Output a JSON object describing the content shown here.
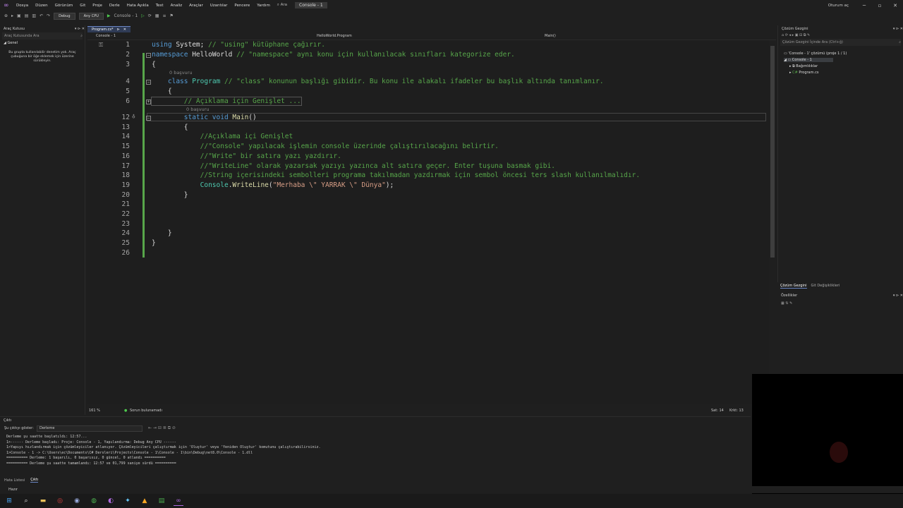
{
  "menubar": {
    "items": [
      "Dosya",
      "Düzen",
      "Görünüm",
      "Git",
      "Proje",
      "Derle",
      "Hata Ayıkla",
      "Test",
      "Analiz",
      "Araçlar",
      "Uzantılar",
      "Pencere",
      "Yardım"
    ],
    "search_label": "Ara",
    "solution_name": "Console - 1",
    "user_label": "Oturum aç"
  },
  "toolbar": {
    "config": "Debug",
    "platform": "Any CPU",
    "run_target": "Console - 1"
  },
  "toolbox": {
    "title": "Araç Kutusu",
    "search_placeholder": "Araç Kutusunda Ara",
    "group": "Genel",
    "empty_message": "Bu grupta kullanılabilir denetim yok. Araç çubuğuna bir öğe eklemek için üzerine sürükleyin."
  },
  "editor": {
    "tab_label": "Program.cs*",
    "project": "Console - 1",
    "class_nav": "HelloWorld.Program",
    "member_nav": "Main()",
    "zoom": "161 %",
    "issues": "Sorun bulunamadı",
    "line_col": "Sat: 14",
    "char_col": "Krkt: 13",
    "refs1": "0 başvuru",
    "refs2": "0 başvuru",
    "lines": [
      {
        "n": "1",
        "t": [
          {
            "c": "kw",
            "s": "using "
          },
          {
            "c": "",
            "s": "System; "
          },
          {
            "c": "cm",
            "s": "// \"using\" kütüphane çağırır."
          }
        ]
      },
      {
        "n": "2",
        "t": [
          {
            "c": "kw",
            "s": "namespace "
          },
          {
            "c": "",
            "s": "HelloWorld "
          },
          {
            "c": "cm",
            "s": "// \"namespace\" aynı konu için kullanılacak sınıfları kategorize eder."
          }
        ]
      },
      {
        "n": "3",
        "t": [
          {
            "c": "",
            "s": "{"
          }
        ]
      },
      {
        "n": "4",
        "t": [
          {
            "c": "",
            "s": "    "
          },
          {
            "c": "kw",
            "s": "class "
          },
          {
            "c": "tp",
            "s": "Program "
          },
          {
            "c": "cm",
            "s": "// \"class\" konunun başlığı gibidir. Bu konu ile alakalı ifadeler bu başlık altında tanımlanır."
          }
        ]
      },
      {
        "n": "5",
        "t": [
          {
            "c": "",
            "s": "    {"
          }
        ]
      },
      {
        "n": "6",
        "t": [
          {
            "c": "",
            "s": "        "
          },
          {
            "c": "cm",
            "s": "// Açıklama için Genişlet ..."
          }
        ]
      },
      {
        "n": "12",
        "t": [
          {
            "c": "",
            "s": "        "
          },
          {
            "c": "kw",
            "s": "static void "
          },
          {
            "c": "mt",
            "s": "Main"
          },
          {
            "c": "",
            "s": "()"
          }
        ]
      },
      {
        "n": "13",
        "t": [
          {
            "c": "",
            "s": "        {"
          }
        ]
      },
      {
        "n": "14",
        "t": [
          {
            "c": "",
            "s": "            "
          },
          {
            "c": "cm",
            "s": "//Açıklama içi Genişlet"
          }
        ]
      },
      {
        "n": "15",
        "t": [
          {
            "c": "",
            "s": "            "
          },
          {
            "c": "cm",
            "s": "//\"Console\" yapılacak işlemin console üzerinde çalıştırılacağını belirtir."
          }
        ]
      },
      {
        "n": "16",
        "t": [
          {
            "c": "",
            "s": "            "
          },
          {
            "c": "cm",
            "s": "//\"Write\" bir satıra yazı yazdırır."
          }
        ]
      },
      {
        "n": "17",
        "t": [
          {
            "c": "",
            "s": "            "
          },
          {
            "c": "cm",
            "s": "//\"WriteLine\" olarak yazarsak yazıyı yazınca alt satıra geçer. Enter tuşuna basmak gibi."
          }
        ]
      },
      {
        "n": "18",
        "t": [
          {
            "c": "",
            "s": "            "
          },
          {
            "c": "cm",
            "s": "//String içerisindeki sembolleri programa takılmadan yazdırmak için sembol öncesi ters slash kullanılmalıdır."
          }
        ]
      },
      {
        "n": "19",
        "t": [
          {
            "c": "",
            "s": "            "
          },
          {
            "c": "tp",
            "s": "Console"
          },
          {
            "c": "",
            "s": "."
          },
          {
            "c": "mt",
            "s": "WriteLine"
          },
          {
            "c": "",
            "s": "("
          },
          {
            "c": "st",
            "s": "\"Merhaba \\\" YARRAK \\\" Dünya\""
          },
          {
            "c": "",
            "s": ");"
          }
        ]
      },
      {
        "n": "20",
        "t": [
          {
            "c": "",
            "s": "        }"
          }
        ]
      },
      {
        "n": "21",
        "t": []
      },
      {
        "n": "22",
        "t": []
      },
      {
        "n": "23",
        "t": []
      },
      {
        "n": "24",
        "t": [
          {
            "c": "",
            "s": "    }"
          }
        ]
      },
      {
        "n": "25",
        "t": [
          {
            "c": "",
            "s": "}"
          }
        ]
      },
      {
        "n": "26",
        "t": []
      }
    ]
  },
  "solution": {
    "title": "Çözüm Gezgini",
    "search_placeholder": "Çözüm Gezgini İçinde Ara (Ctrl+ğ)",
    "root": "'Console - 1' çözümü (proje 1 / 1)",
    "project": "Console - 1",
    "deps": "Bağımlılıklar",
    "file": "Program.cs",
    "tab1": "Çözüm Gezgini",
    "tab2": "Git Değişiklikleri",
    "props_title": "Özellikler"
  },
  "output": {
    "title": "Çıktı",
    "show_label": "Şu çıktıyı göster:",
    "source": "Derleme",
    "lines": [
      "Derleme şu saatte başlatıldı: 12:57...",
      "1>------ Derleme başladı: Proje: Console - 1, Yapılandırma: Debug Any CPU ------",
      "1>Yapıyı hızlandırmak için çözümleyiciler atlanıyor. Çözümleyicileri çalıştırmak için 'Oluştur' veya 'Yeniden Oluştur' komutunu çalıştırabilirsiniz.",
      "1>Console - 1 -> C:\\Users\\ec\\Documents\\C# Dersleri\\Projects\\Console - 1\\Console - 1\\bin\\Debug\\net8.0\\Console - 1.dll",
      "========== Derleme: 1 başarılı, 0 başarısız, 0 güncel, 0 atlandı ==========",
      "========== Derleme şu saatte tamamlandı: 12:57 ve 01,799 saniye sürdü =========="
    ]
  },
  "bottom_tabs": [
    "Hata Listesi",
    "Çıktı"
  ],
  "status": "Hazır"
}
